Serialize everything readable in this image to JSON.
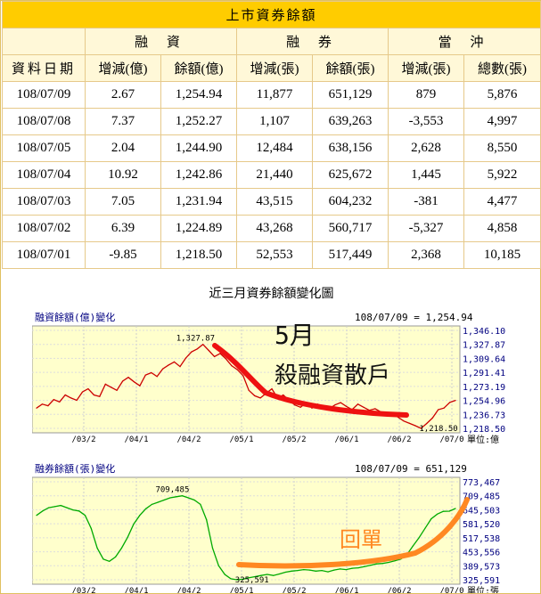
{
  "table": {
    "title": "上市資券餘額",
    "groups": [
      "融 資",
      "融 券",
      "當 沖"
    ],
    "headers": [
      "資料日期",
      "增減(億)",
      "餘額(億)",
      "增減(張)",
      "餘額(張)",
      "增減(張)",
      "總數(張)"
    ],
    "rows": [
      [
        "108/07/09",
        "2.67",
        "1,254.94",
        "11,877",
        "651,129",
        "879",
        "5,876"
      ],
      [
        "108/07/08",
        "7.37",
        "1,252.27",
        "1,107",
        "639,263",
        "-3,553",
        "4,997"
      ],
      [
        "108/07/05",
        "2.04",
        "1,244.90",
        "12,484",
        "638,156",
        "2,628",
        "8,550"
      ],
      [
        "108/07/04",
        "10.92",
        "1,242.86",
        "21,440",
        "625,672",
        "1,445",
        "5,922"
      ],
      [
        "108/07/03",
        "7.05",
        "1,231.94",
        "43,515",
        "604,232",
        "-381",
        "4,477"
      ],
      [
        "108/07/02",
        "6.39",
        "1,224.89",
        "43,268",
        "560,717",
        "-5,327",
        "4,858"
      ],
      [
        "108/07/01",
        "-9.85",
        "1,218.50",
        "52,553",
        "517,449",
        "2,368",
        "10,185"
      ]
    ]
  },
  "charts_title": "近三月資券餘額變化圖",
  "chart_data": [
    {
      "type": "line",
      "title": "融資餘額(億)變化",
      "header_right": "108/07/09 = 1,254.94",
      "unit": "單位:億",
      "x_ticks": [
        "/03/2",
        "/04/1",
        "/04/2",
        "/05/1",
        "/05/2",
        "/06/1",
        "/06/2",
        "/07/0"
      ],
      "y_ticks": [
        "1,346.10",
        "1,327.87",
        "1,309.64",
        "1,291.41",
        "1,273.19",
        "1,254.96",
        "1,236.73",
        "1,218.50"
      ],
      "ylim": [
        1218.5,
        1346.1
      ],
      "max_label": "1,327.87",
      "min_label": "1,218.50",
      "series": [
        {
          "color": "#cc0000",
          "values": [
            1245,
            1250,
            1248,
            1256,
            1253,
            1262,
            1258,
            1255,
            1266,
            1270,
            1262,
            1260,
            1276,
            1272,
            1268,
            1280,
            1285,
            1279,
            1274,
            1288,
            1291,
            1286,
            1296,
            1301,
            1305,
            1299,
            1310,
            1318,
            1322,
            1327.87,
            1320,
            1312,
            1316,
            1309,
            1300,
            1295,
            1287,
            1268,
            1261,
            1258,
            1264,
            1270,
            1258,
            1262,
            1255,
            1249,
            1246,
            1252,
            1245,
            1250,
            1247,
            1244,
            1249,
            1252,
            1247,
            1243,
            1250,
            1246,
            1242,
            1244,
            1240,
            1235,
            1238,
            1233,
            1228,
            1225,
            1222,
            1218.5,
            1224.89,
            1231.94,
            1242.86,
            1244.9,
            1252.27,
            1254.94
          ]
        }
      ]
    },
    {
      "type": "line",
      "title": "融券餘額(張)變化",
      "header_right": "108/07/09 = 651,129",
      "unit": "單位:張",
      "x_ticks": [
        "/03/2",
        "/04/1",
        "/04/2",
        "/05/1",
        "/05/2",
        "/06/1",
        "/06/2",
        "/07/0"
      ],
      "y_ticks": [
        "773,467",
        "709,485",
        "645,503",
        "581,520",
        "517,538",
        "453,556",
        "389,573",
        "325,591"
      ],
      "ylim": [
        325591,
        773467
      ],
      "max_label": "709,485",
      "min_label": "325,591",
      "series": [
        {
          "color": "#00aa00",
          "values": [
            620000,
            640000,
            655000,
            660000,
            665000,
            655000,
            645000,
            640000,
            620000,
            560000,
            470000,
            420000,
            410000,
            430000,
            470000,
            520000,
            580000,
            620000,
            650000,
            670000,
            680000,
            690000,
            700000,
            705000,
            709485,
            700000,
            690000,
            670000,
            600000,
            470000,
            390000,
            350000,
            330000,
            325591,
            328000,
            335000,
            340000,
            345000,
            350000,
            345000,
            352000,
            360000,
            365000,
            368000,
            372000,
            370000,
            365000,
            368000,
            362000,
            370000,
            375000,
            372000,
            378000,
            380000,
            386000,
            392000,
            398000,
            400000,
            405000,
            412000,
            420000,
            440000,
            480000,
            517449,
            560717,
            604232,
            625672,
            638156,
            639263,
            651129
          ]
        }
      ]
    }
  ],
  "annotations": {
    "chart1_label_top": "5月",
    "chart1_label_bottom": "殺融資散戶",
    "chart2_label": "回單"
  }
}
